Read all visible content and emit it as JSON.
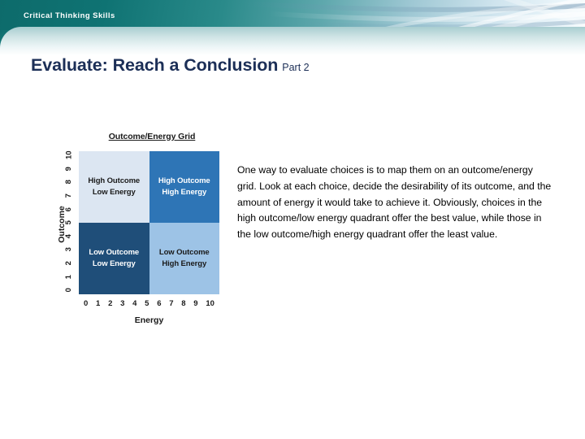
{
  "banner": {
    "title": "Critical Thinking Skills"
  },
  "slide": {
    "title_main": "Evaluate: Reach a Conclusion",
    "title_sub": "Part 2"
  },
  "figure": {
    "title": "Outcome/Energy Grid",
    "y_axis_label": "Outcome",
    "x_axis_label": "Energy",
    "y_ticks": [
      "0",
      "1",
      "2",
      "3",
      "4",
      "5",
      "6",
      "7",
      "8",
      "9",
      "10"
    ],
    "x_ticks": [
      "0",
      "1",
      "2",
      "3",
      "4",
      "5",
      "6",
      "7",
      "8",
      "9",
      "10"
    ],
    "quadrants": [
      {
        "id": "high-outcome-low-energy",
        "line1": "High Outcome",
        "line2": "Low Energy",
        "bg": "#dce6f2",
        "fg": "#1a1a1a"
      },
      {
        "id": "high-outcome-high-energy",
        "line1": "High Outcome",
        "line2": "High Energy",
        "bg": "#2e75b6",
        "fg": "#ffffff"
      },
      {
        "id": "low-outcome-low-energy",
        "line1": "Low Outcome",
        "line2": "Low Energy",
        "bg": "#1f4e79",
        "fg": "#ffffff"
      },
      {
        "id": "low-outcome-high-energy",
        "line1": "Low Outcome",
        "line2": "High Energy",
        "bg": "#9dc3e6",
        "fg": "#1a1a1a"
      }
    ]
  },
  "chart_data": {
    "type": "table",
    "title": "Outcome/Energy Grid",
    "xlabel": "Energy",
    "ylabel": "Outcome",
    "xlim": [
      0,
      10
    ],
    "ylim": [
      0,
      10
    ],
    "grid": false,
    "legend": "none",
    "categories": [
      "Low Energy",
      "High Energy"
    ],
    "series": [
      {
        "name": "High Outcome",
        "values": [
          "High Outcome Low Energy",
          "High Outcome High Energy"
        ]
      },
      {
        "name": "Low Outcome",
        "values": [
          "Low Outcome Low Energy",
          "Low Outcome High Energy"
        ]
      }
    ],
    "annotations": [
      "High Outcome Low Energy",
      "High Outcome High Energy",
      "Low Outcome Low Energy",
      "Low Outcome High Energy"
    ]
  },
  "body": {
    "paragraph": "One way to evaluate choices is to map them on an outcome/energy grid. Look at each choice, decide the desirability of its outcome, and the amount of energy it would take to achieve it. Obviously, choices in the high outcome/low energy quadrant offer the best value, while those in the low outcome/high energy quadrant offer the least value."
  },
  "colors": {
    "banner_teal": "#0d6b6b",
    "title_navy": "#1c2f57"
  }
}
